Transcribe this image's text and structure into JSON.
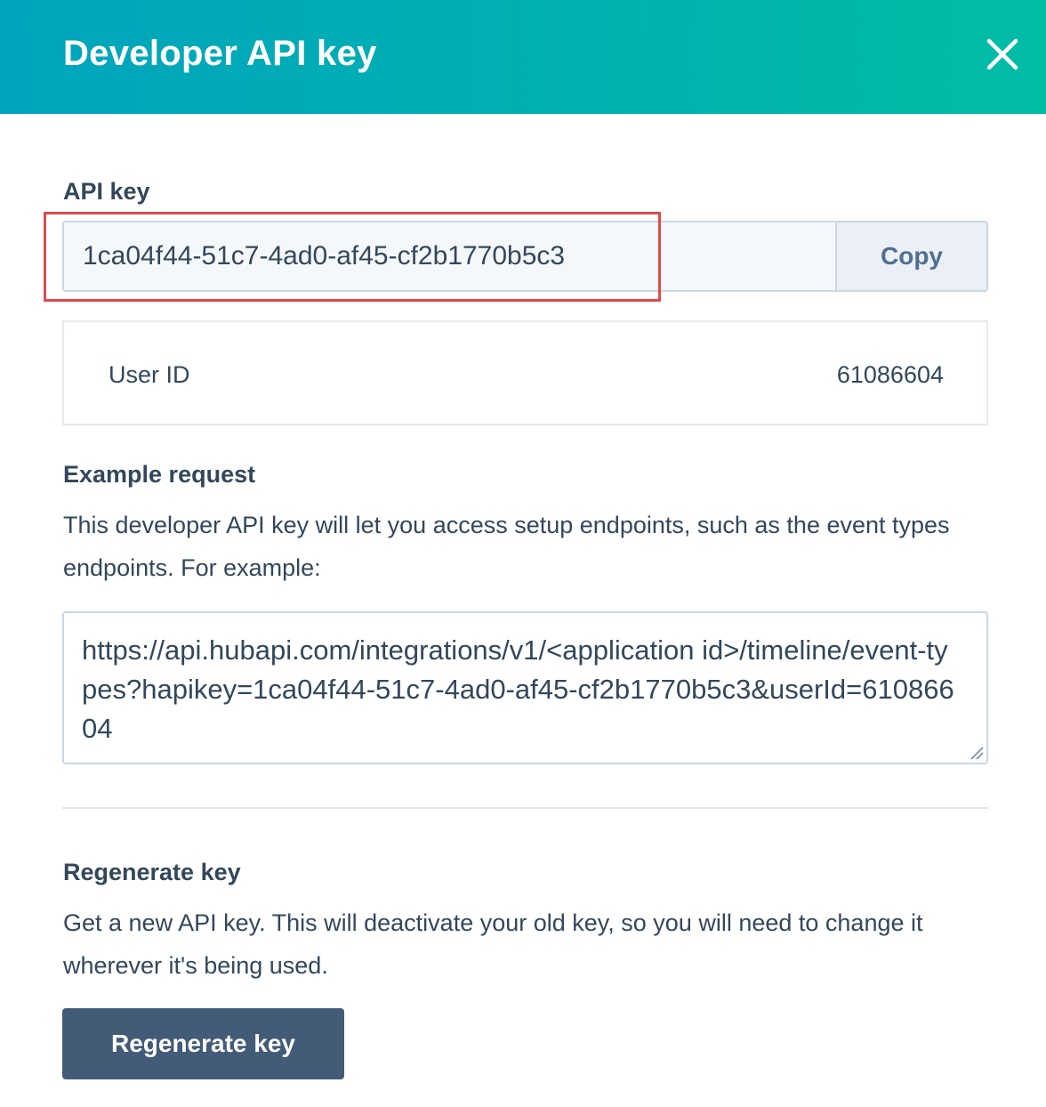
{
  "dialog": {
    "title": "Developer API key"
  },
  "api_key": {
    "label": "API key",
    "value": "1ca04f44-51c7-4ad0-af45-cf2b1770b5c3",
    "copy_label": "Copy"
  },
  "user": {
    "label": "User ID",
    "value": "61086604"
  },
  "example": {
    "heading": "Example request",
    "description": "This developer API key will let you access setup endpoints, such as the event types endpoints. For example:",
    "request": "https://api.hubapi.com/integrations/v1/<application id>/timeline/event-types?hapikey=1ca04f44-51c7-4ad0-af45-cf2b1770b5c3&userId=61086604"
  },
  "regenerate": {
    "heading": "Regenerate key",
    "description": "Get a new API key. This will deactivate your old key, so you will need to change it wherever it's being used.",
    "button_label": "Regenerate key"
  },
  "colors": {
    "header_gradient_start": "#00a4bd",
    "header_gradient_end": "#00bda5",
    "primary_button": "#425b76",
    "highlight_border": "#dd4b4b",
    "text": "#33475b"
  },
  "icons": {
    "close": "close-icon",
    "resize": "resize-handle-icon"
  }
}
